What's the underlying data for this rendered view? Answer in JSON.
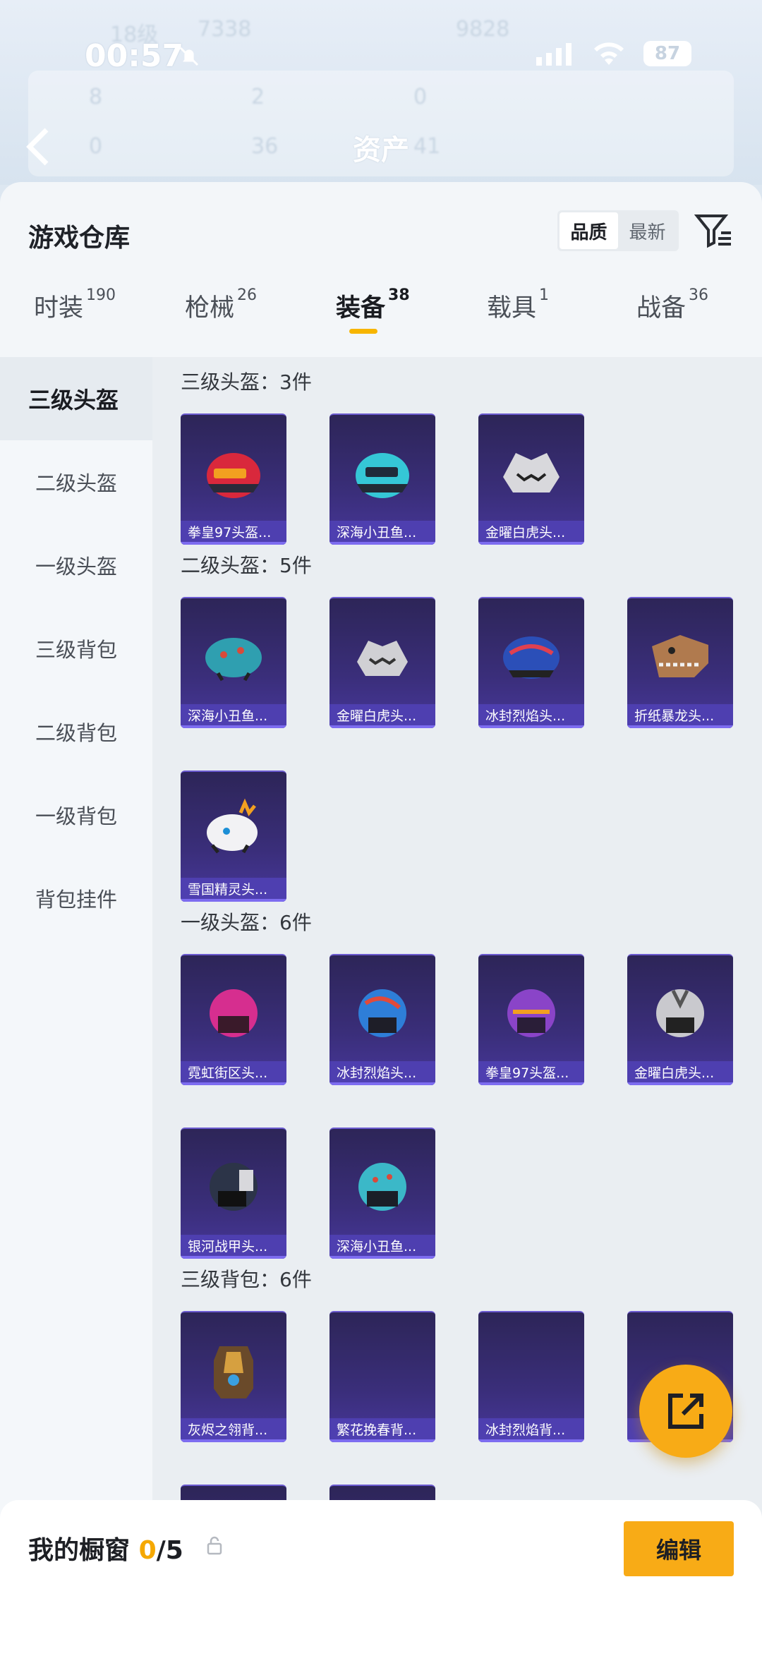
{
  "status_bar": {
    "time": "00:57",
    "battery": "87"
  },
  "header": {
    "title": "资产",
    "ghost": {
      "level": "18级",
      "score": "7338",
      "value": "9828",
      "s1": "8",
      "s2": "2",
      "s3": "0",
      "s4": "0",
      "s5": "36",
      "s6": "41"
    }
  },
  "sheet": {
    "title": "游戏仓库",
    "sort": {
      "quality": "品质",
      "newest": "最新"
    }
  },
  "tabs": [
    {
      "label": "时装",
      "count": "190"
    },
    {
      "label": "枪械",
      "count": "26"
    },
    {
      "label": "装备",
      "count": "38"
    },
    {
      "label": "载具",
      "count": "1"
    },
    {
      "label": "战备",
      "count": "36"
    }
  ],
  "sidebar": [
    "三级头盔",
    "二级头盔",
    "一级头盔",
    "三级背包",
    "二级背包",
    "一级背包",
    "背包挂件"
  ],
  "sections": [
    {
      "title": "三级头盔：3件",
      "items": [
        "拳皇97头盔...",
        "深海小丑鱼...",
        "金曜白虎头..."
      ]
    },
    {
      "title": "二级头盔：5件",
      "items": [
        "深海小丑鱼...",
        "金曜白虎头...",
        "冰封烈焰头...",
        "折纸暴龙头...",
        "雪国精灵头..."
      ]
    },
    {
      "title": "一级头盔：6件",
      "items": [
        "霓虹街区头...",
        "冰封烈焰头...",
        "拳皇97头盔...",
        "金曜白虎头...",
        "银河战甲头...",
        "深海小丑鱼..."
      ]
    },
    {
      "title": "三级背包：6件",
      "items": [
        "灰烬之翎背...",
        "繁花挽春背...",
        "冰封烈焰背...",
        ""
      ]
    }
  ],
  "bottom": {
    "showcase_label": "我的橱窗",
    "showcase_count": "0",
    "showcase_total": "/5",
    "edit_label": "编辑"
  },
  "colors": {
    "accent": "#f8ab16",
    "card": "#3a2e7a",
    "card_label": "#4e3fb0"
  }
}
